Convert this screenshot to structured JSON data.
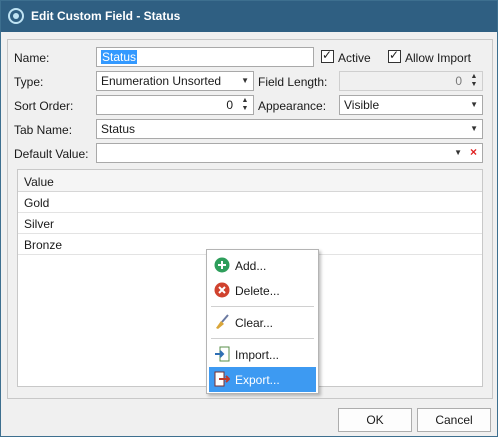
{
  "window": {
    "title": "Edit Custom Field - Status"
  },
  "form": {
    "name_label": "Name:",
    "name_value": "Status",
    "active_label": "Active",
    "allow_import_label": "Allow Import",
    "type_label": "Type:",
    "type_value": "Enumeration Unsorted",
    "field_length_label": "Field Length:",
    "field_length_value": "0",
    "sort_order_label": "Sort Order:",
    "sort_order_value": "0",
    "appearance_label": "Appearance:",
    "appearance_value": "Visible",
    "tab_name_label": "Tab Name:",
    "tab_name_value": "Status",
    "default_value_label": "Default Value:",
    "default_value_value": ""
  },
  "grid": {
    "header": "Value",
    "rows": [
      "Gold",
      "Silver",
      "Bronze"
    ]
  },
  "context_menu": {
    "items": [
      {
        "label": "Add...",
        "icon": "add-icon"
      },
      {
        "label": "Delete...",
        "icon": "delete-icon"
      },
      {
        "label": "Clear...",
        "icon": "broom-icon"
      },
      {
        "label": "Import...",
        "icon": "import-icon"
      },
      {
        "label": "Export...",
        "icon": "export-icon"
      }
    ],
    "highlighted": "Export..."
  },
  "buttons": {
    "ok": "OK",
    "cancel": "Cancel"
  },
  "colors": {
    "titlebar": "#2f5f82",
    "highlight": "#3d9af2",
    "add": "#2e9e5b",
    "delete": "#d0422e",
    "clear": "#e02020"
  }
}
